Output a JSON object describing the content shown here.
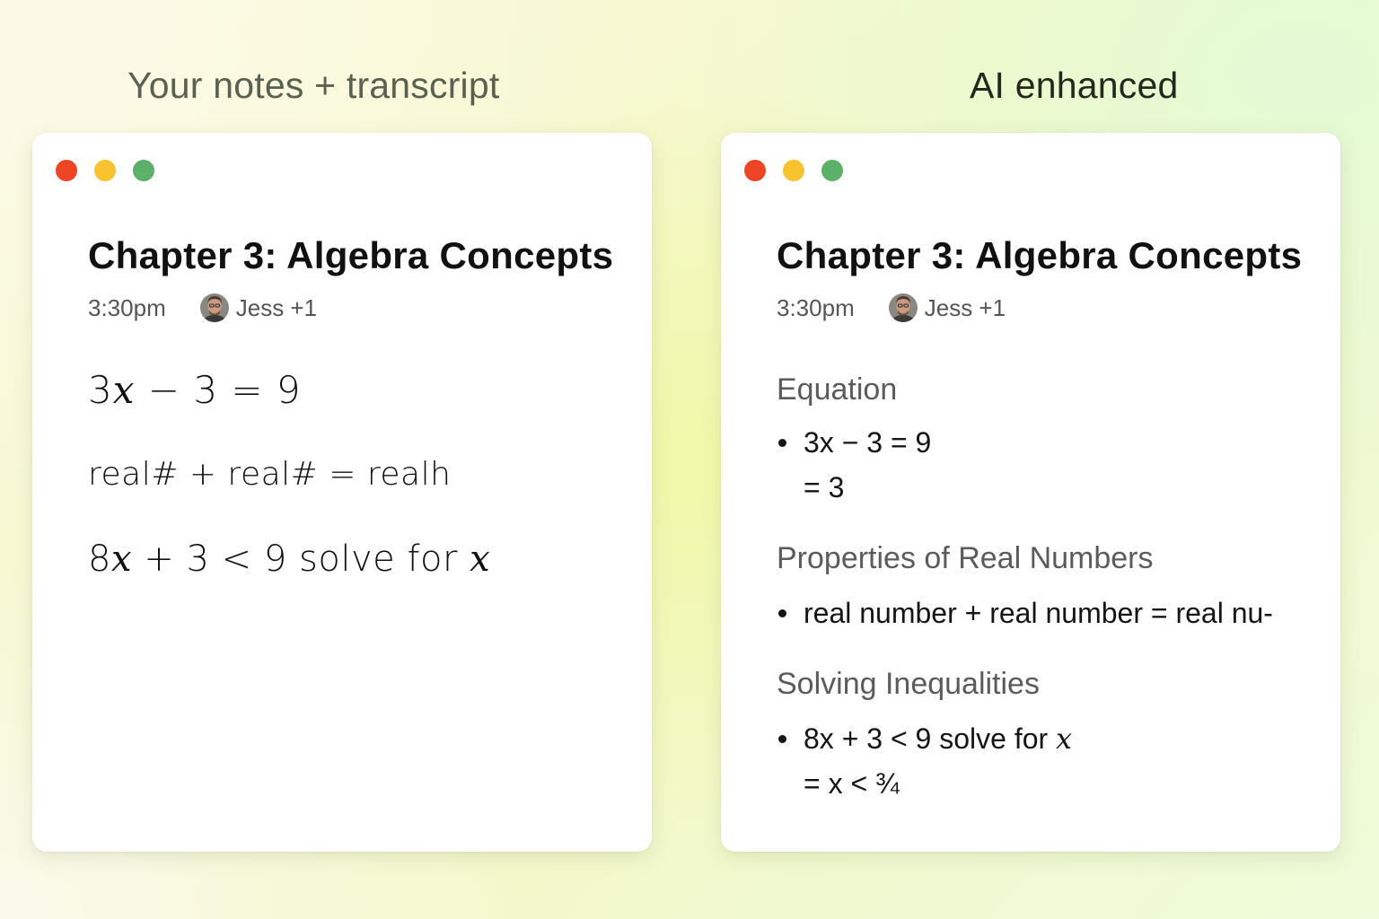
{
  "left_panel": {
    "heading": "Your notes + transcript",
    "window": {
      "title": "Chapter 3: Algebra Concepts",
      "time": "3:30pm",
      "participants": "Jess +1",
      "notes": [
        {
          "before": "3",
          "var": "x",
          "after": " − 3 = 9"
        },
        {
          "text": "real# + real# = realh"
        },
        {
          "before": "8",
          "var": "x",
          "middle": " + 3 < 9 solve for ",
          "var2": "x"
        }
      ]
    }
  },
  "right_panel": {
    "heading": "AI enhanced",
    "window": {
      "title": "Chapter 3: Algebra Concepts",
      "time": "3:30pm",
      "participants": "Jess +1",
      "sections": [
        {
          "heading": "Equation",
          "bullet": "3x − 3 = 9",
          "continuation": "= 3"
        },
        {
          "heading": "Properties of Real Numbers",
          "bullet": "real number + real number = real nu-"
        },
        {
          "heading": "Solving Inequalities",
          "bullet_text": "8x + 3 < 9 solve for ",
          "bullet_var": "x",
          "continuation": "= x < ¾"
        }
      ]
    }
  },
  "colors": {
    "close": "#ee4526",
    "minimize": "#f9c22f",
    "maximize": "#5cb06a"
  },
  "icons": {
    "avatar": "person-avatar-photo"
  }
}
